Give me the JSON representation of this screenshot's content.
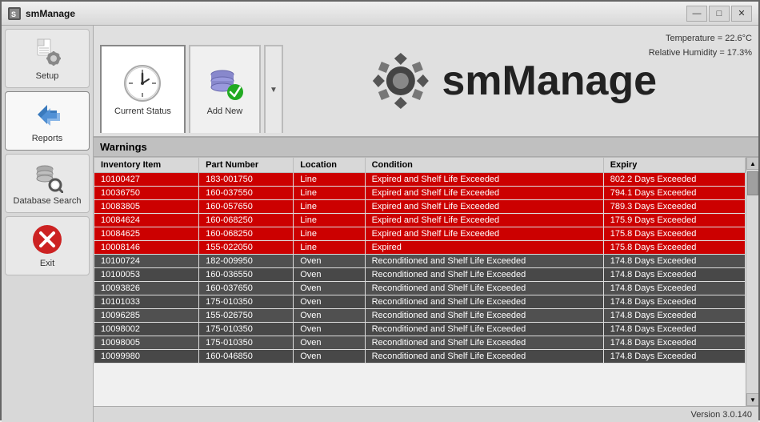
{
  "window": {
    "title": "smManage",
    "controls": {
      "minimize": "—",
      "maximize": "□",
      "close": "✕"
    }
  },
  "sidebar": {
    "items": [
      {
        "id": "setup",
        "label": "Setup"
      },
      {
        "id": "reports",
        "label": "Reports"
      },
      {
        "id": "database-search",
        "label": "Database\nSearch"
      },
      {
        "id": "exit",
        "label": "Exit"
      }
    ]
  },
  "toolbar": {
    "current_status_label": "Current Status",
    "add_new_label": "Add New",
    "temperature": "Temperature = 22.6°C",
    "humidity": "Relative Humidity = 17.3%"
  },
  "logo": {
    "text": "smManage"
  },
  "table": {
    "title": "Warnings",
    "columns": [
      "Inventory Item",
      "Part Number",
      "Location",
      "Condition",
      "Expiry"
    ],
    "rows": [
      {
        "item": "10100427",
        "part": "183-001750",
        "location": "Line",
        "condition": "Expired and Shelf Life Exceeded",
        "expiry": "802.2 Days Exceeded",
        "type": "expired"
      },
      {
        "item": "10036750",
        "part": "160-037550",
        "location": "Line",
        "condition": "Expired and Shelf Life Exceeded",
        "expiry": "794.1 Days Exceeded",
        "type": "expired"
      },
      {
        "item": "10083805",
        "part": "160-057650",
        "location": "Line",
        "condition": "Expired and Shelf Life Exceeded",
        "expiry": "789.3 Days Exceeded",
        "type": "expired"
      },
      {
        "item": "10084624",
        "part": "160-068250",
        "location": "Line",
        "condition": "Expired and Shelf Life Exceeded",
        "expiry": "175.9 Days Exceeded",
        "type": "expired"
      },
      {
        "item": "10084625",
        "part": "160-068250",
        "location": "Line",
        "condition": "Expired and Shelf Life Exceeded",
        "expiry": "175.8 Days Exceeded",
        "type": "expired"
      },
      {
        "item": "10008146",
        "part": "155-022050",
        "location": "Line",
        "condition": "Expired",
        "expiry": "175.8 Days Exceeded",
        "type": "expired"
      },
      {
        "item": "10100724",
        "part": "182-009950",
        "location": "Oven",
        "condition": "Reconditioned and Shelf Life Exceeded",
        "expiry": "174.8 Days Exceeded",
        "type": "normal"
      },
      {
        "item": "10100053",
        "part": "160-036550",
        "location": "Oven",
        "condition": "Reconditioned and Shelf Life Exceeded",
        "expiry": "174.8 Days Exceeded",
        "type": "normal"
      },
      {
        "item": "10093826",
        "part": "160-037650",
        "location": "Oven",
        "condition": "Reconditioned and Shelf Life Exceeded",
        "expiry": "174.8 Days Exceeded",
        "type": "normal"
      },
      {
        "item": "10101033",
        "part": "175-010350",
        "location": "Oven",
        "condition": "Reconditioned and Shelf Life Exceeded",
        "expiry": "174.8 Days Exceeded",
        "type": "normal"
      },
      {
        "item": "10096285",
        "part": "155-026750",
        "location": "Oven",
        "condition": "Reconditioned and Shelf Life Exceeded",
        "expiry": "174.8 Days Exceeded",
        "type": "normal"
      },
      {
        "item": "10098002",
        "part": "175-010350",
        "location": "Oven",
        "condition": "Reconditioned and Shelf Life Exceeded",
        "expiry": "174.8 Days Exceeded",
        "type": "normal"
      },
      {
        "item": "10098005",
        "part": "175-010350",
        "location": "Oven",
        "condition": "Reconditioned and Shelf Life Exceeded",
        "expiry": "174.8 Days Exceeded",
        "type": "normal"
      },
      {
        "item": "10099980",
        "part": "160-046850",
        "location": "Oven",
        "condition": "Reconditioned and Shelf Life Exceeded",
        "expiry": "174.8 Days Exceeded",
        "type": "normal"
      }
    ]
  },
  "statusbar": {
    "version": "Version 3.0.140"
  }
}
